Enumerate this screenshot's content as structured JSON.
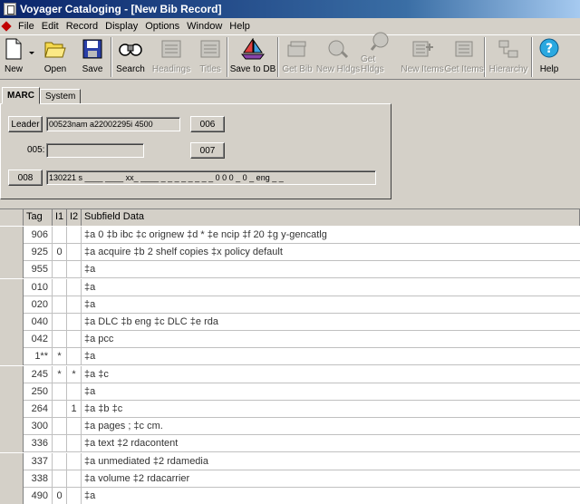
{
  "window": {
    "title": "Voyager Cataloging - [New Bib Record]"
  },
  "menu": [
    "File",
    "Edit",
    "Record",
    "Display",
    "Options",
    "Window",
    "Help"
  ],
  "toolbar": [
    {
      "label": "New",
      "icon": "new-document-icon",
      "enabled": true
    },
    {
      "label": "Open",
      "icon": "open-folder-icon",
      "enabled": true
    },
    {
      "label": "Save",
      "icon": "save-disk-icon",
      "enabled": true
    },
    {
      "label": "Search",
      "icon": "search-binoculars-icon",
      "enabled": true
    },
    {
      "label": "Headings",
      "icon": "headings-icon",
      "enabled": false
    },
    {
      "label": "Titles",
      "icon": "titles-icon",
      "enabled": false
    },
    {
      "label": "Save to DB",
      "icon": "save-to-db-icon",
      "enabled": true
    },
    {
      "label": "Get Bib",
      "icon": "get-bib-icon",
      "enabled": false
    },
    {
      "label": "New Hldgs",
      "icon": "new-holdings-icon",
      "enabled": false
    },
    {
      "label": "Get Hldgs",
      "icon": "get-holdings-icon",
      "enabled": false
    },
    {
      "label": "New Items",
      "icon": "new-items-icon",
      "enabled": false
    },
    {
      "label": "Get Items",
      "icon": "get-items-icon",
      "enabled": false
    },
    {
      "label": "Hierarchy",
      "icon": "hierarchy-icon",
      "enabled": false
    },
    {
      "label": "Help",
      "icon": "help-question-icon",
      "enabled": true
    }
  ],
  "tabs": [
    {
      "label": "MARC",
      "active": true
    },
    {
      "label": "System",
      "active": false
    }
  ],
  "marc_panel": {
    "leader_button": "Leader",
    "leader_value": "00523nam a22002295i 4500",
    "btn_006": "006",
    "label_005": "005:",
    "value_005": "",
    "btn_007": "007",
    "btn_008": "008",
    "value_008": "130221  s ____  ____  xx_  ____  _ _ _ _  _ _ _ _  0 0 0 _ 0 _ eng _ _"
  },
  "grid": {
    "headers": [
      "Tag",
      "I1",
      "I2",
      "Subfield Data"
    ],
    "rows": [
      {
        "tag": "906",
        "i1": "",
        "i2": "",
        "data": "‡a 0 ‡b ibc ‡c orignew ‡d * ‡e ncip ‡f 20 ‡g y-gencatlg"
      },
      {
        "tag": "925",
        "i1": "0",
        "i2": "",
        "data": "‡a acquire ‡b 2 shelf copies ‡x policy default"
      },
      {
        "tag": "955",
        "i1": "",
        "i2": "",
        "data": "‡a"
      },
      {
        "tag": "010",
        "i1": "",
        "i2": "",
        "data": "‡a"
      },
      {
        "tag": "020",
        "i1": "",
        "i2": "",
        "data": "‡a"
      },
      {
        "tag": "040",
        "i1": "",
        "i2": "",
        "data": "‡a DLC ‡b eng ‡c DLC ‡e rda"
      },
      {
        "tag": "042",
        "i1": "",
        "i2": "",
        "data": "‡a pcc"
      },
      {
        "tag": "1**",
        "i1": "*",
        "i2": "",
        "data": "‡a"
      },
      {
        "tag": "245",
        "i1": "*",
        "i2": "*",
        "data": "‡a ‡c"
      },
      {
        "tag": "250",
        "i1": "",
        "i2": "",
        "data": "‡a"
      },
      {
        "tag": "264",
        "i1": "",
        "i2": "1",
        "data": "‡a ‡b ‡c"
      },
      {
        "tag": "300",
        "i1": "",
        "i2": "",
        "data": "‡a pages ; ‡c cm."
      },
      {
        "tag": "336",
        "i1": "",
        "i2": "",
        "data": "‡a text ‡2 rdacontent"
      },
      {
        "tag": "337",
        "i1": "",
        "i2": "",
        "data": "‡a unmediated ‡2 rdamedia"
      },
      {
        "tag": "338",
        "i1": "",
        "i2": "",
        "data": "‡a volume ‡2 rdacarrier"
      },
      {
        "tag": "490",
        "i1": "0",
        "i2": "",
        "data": "‡a"
      }
    ]
  }
}
